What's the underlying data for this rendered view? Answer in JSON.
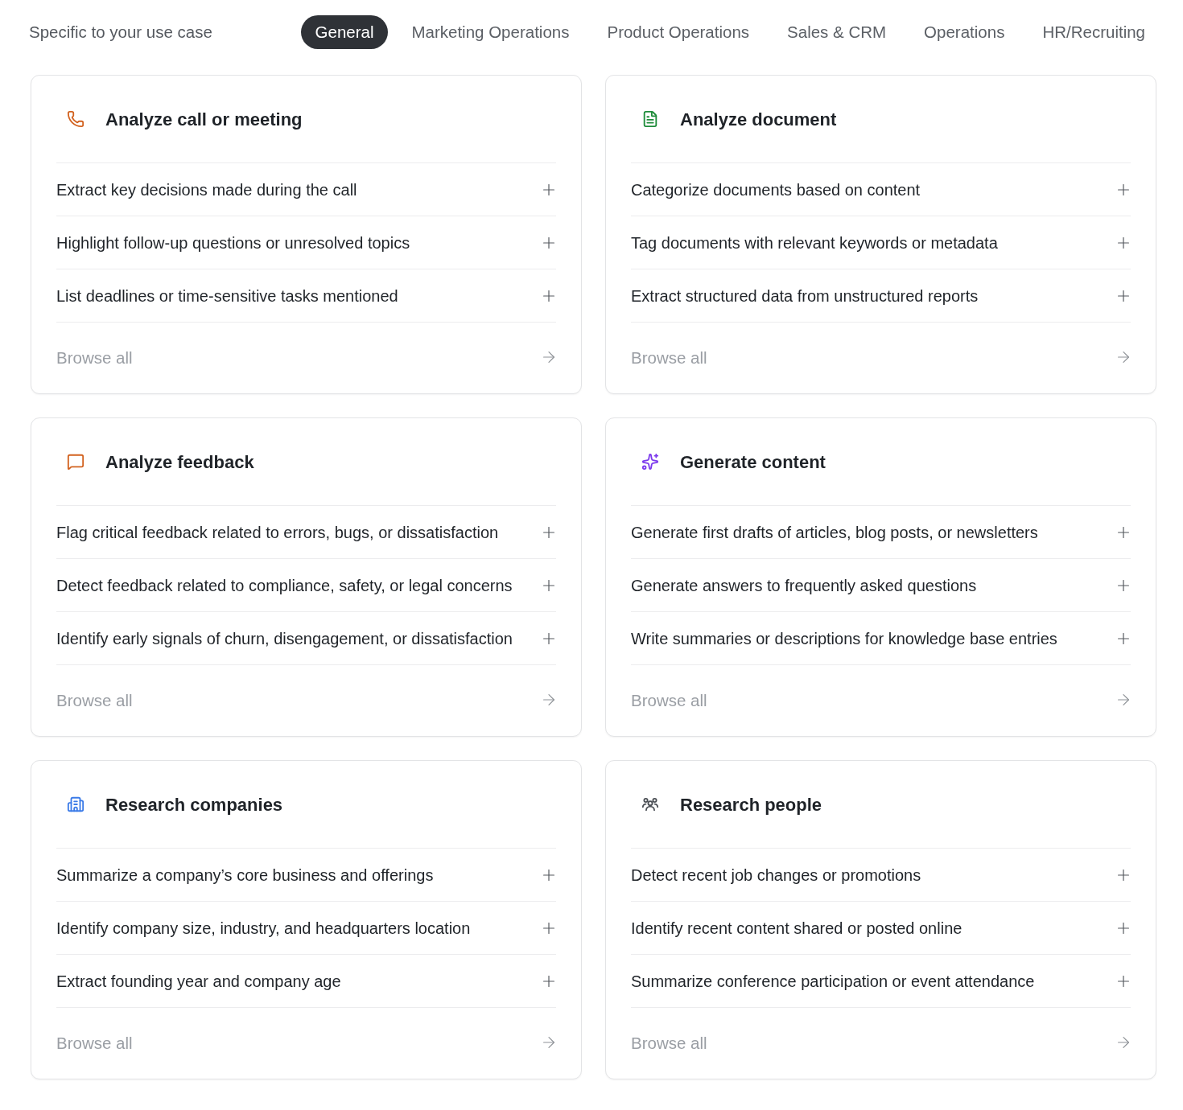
{
  "header": {
    "label": "Specific to your use case"
  },
  "tabs": [
    {
      "label": "General",
      "selected": true
    },
    {
      "label": "Marketing Operations",
      "selected": false
    },
    {
      "label": "Product Operations",
      "selected": false
    },
    {
      "label": "Sales & CRM",
      "selected": false
    },
    {
      "label": "Operations",
      "selected": false
    },
    {
      "label": "HR/Recruiting",
      "selected": false
    }
  ],
  "cards": [
    {
      "title": "Analyze call or meeting",
      "color": "#d2621f",
      "items": [
        "Extract key decisions made during the call",
        "Highlight follow-up questions or unresolved topics",
        "List deadlines or time-sensitive tasks mentioned"
      ],
      "browse_label": "Browse all"
    },
    {
      "title": "Analyze document",
      "color": "#1e8c3a",
      "items": [
        "Categorize documents based on content",
        "Tag documents with relevant keywords or metadata",
        "Extract structured data from unstructured reports"
      ],
      "browse_label": "Browse all"
    },
    {
      "title": "Analyze feedback",
      "color": "#d2621f",
      "items": [
        "Flag critical feedback related to errors, bugs, or dissatisfaction",
        "Detect feedback related to compliance, safety, or legal concerns",
        "Identify early signals of churn, disengagement, or dissatisfaction"
      ],
      "browse_label": "Browse all"
    },
    {
      "title": "Generate content",
      "color": "#7c3aed",
      "items": [
        "Generate first drafts of articles, blog posts, or newsletters",
        "Generate answers to frequently asked questions",
        "Write summaries or descriptions for knowledge base entries"
      ],
      "browse_label": "Browse all"
    },
    {
      "title": "Research companies",
      "color": "#3b7be8",
      "items": [
        "Summarize a company’s core business and offerings",
        "Identify company size, industry, and headquarters location",
        "Extract founding year and company age"
      ],
      "browse_label": "Browse all"
    },
    {
      "title": "Research people",
      "color": "#4b4f55",
      "items": [
        "Detect recent job changes or promotions",
        "Identify recent content shared or posted online",
        "Summarize conference participation or event attendance"
      ],
      "browse_label": "Browse all"
    }
  ]
}
